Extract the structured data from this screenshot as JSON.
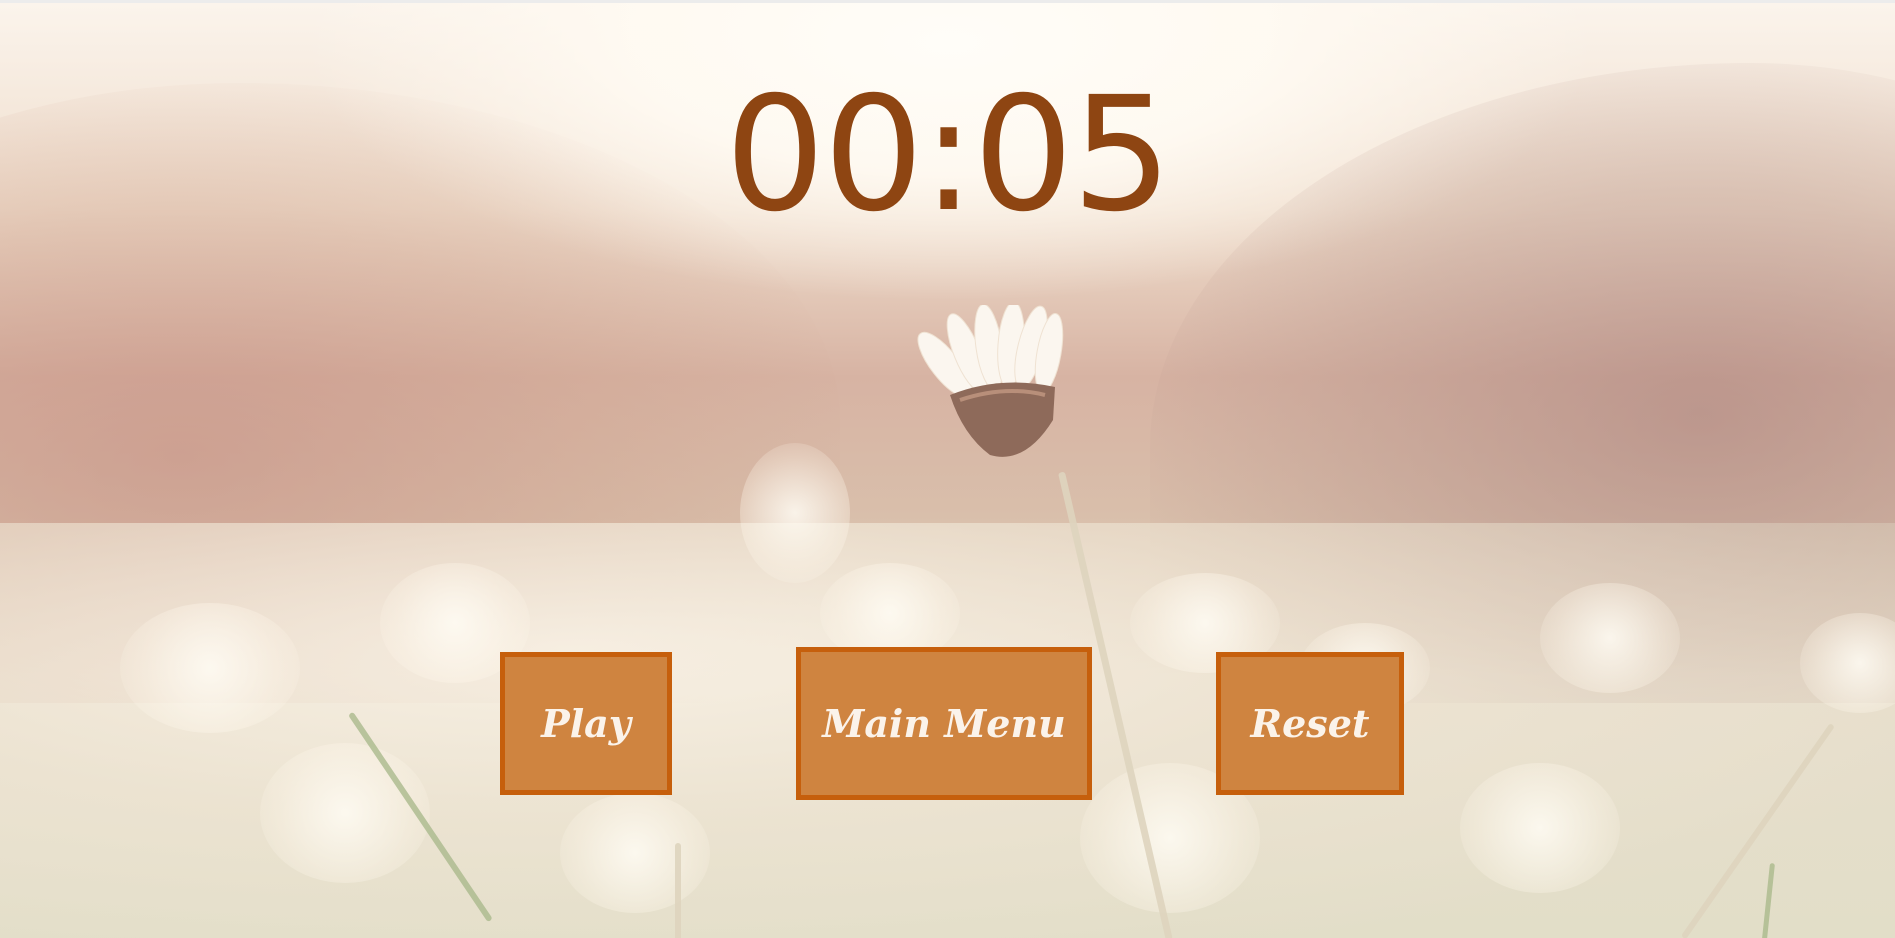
{
  "timer": {
    "display": "00:05"
  },
  "buttons": {
    "play_label": "Play",
    "main_menu_label": "Main Menu",
    "reset_label": "Reset"
  },
  "colors": {
    "timer_text": "#8e4512",
    "button_fill": "#cf8440",
    "button_border": "#c65f0c",
    "button_text": "#fbf3ea"
  }
}
